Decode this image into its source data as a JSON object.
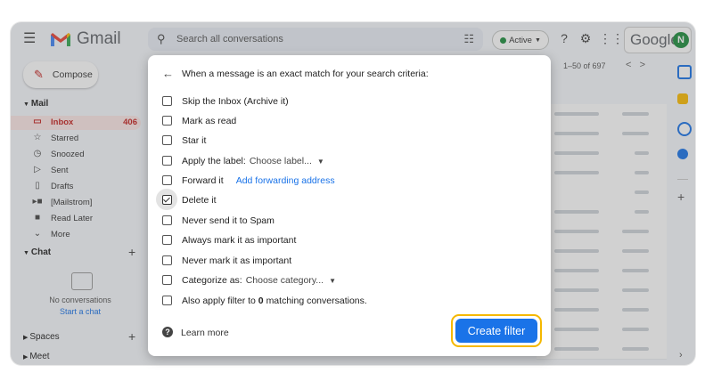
{
  "app": {
    "logo_text": "Gmail",
    "brand_text": "Google",
    "avatar_letter": "N"
  },
  "search": {
    "placeholder": "Search all conversations"
  },
  "status": {
    "label": "Active",
    "color": "#1e8e3e"
  },
  "compose": {
    "label": "Compose"
  },
  "sidebar": {
    "mail_section": "Mail",
    "items": [
      {
        "label": "Inbox",
        "count": "406",
        "icon": "inbox-icon",
        "selected": true
      },
      {
        "label": "Starred",
        "icon": "star-icon"
      },
      {
        "label": "Snoozed",
        "icon": "clock-icon"
      },
      {
        "label": "Sent",
        "icon": "send-icon"
      },
      {
        "label": "Drafts",
        "icon": "draft-icon"
      },
      {
        "label": "[Mailstrom]",
        "icon": "label-icon"
      },
      {
        "label": "Read Later",
        "icon": "label-icon"
      },
      {
        "label": "More",
        "icon": "chevron-down-icon"
      }
    ],
    "chat_section": "Chat",
    "no_conversations": "No conversations",
    "start_chat": "Start a chat",
    "spaces_section": "Spaces",
    "meet_section": "Meet"
  },
  "mail": {
    "range": "1–50 of 697"
  },
  "filter_dialog": {
    "title": "When a message is an exact match for your search criteria:",
    "options": [
      {
        "label": "Skip the Inbox (Archive it)",
        "checked": false
      },
      {
        "label": "Mark as read",
        "checked": false
      },
      {
        "label": "Star it",
        "checked": false
      },
      {
        "label": "Apply the label:",
        "dropdown": "Choose label...",
        "checked": false
      },
      {
        "label": "Forward it",
        "link": "Add forwarding address",
        "checked": false
      },
      {
        "label": "Delete it",
        "checked": true
      },
      {
        "label": "Never send it to Spam",
        "checked": false
      },
      {
        "label": "Always mark it as important",
        "checked": false
      },
      {
        "label": "Never mark it as important",
        "checked": false
      },
      {
        "label": "Categorize as:",
        "dropdown": "Choose category...",
        "checked": false
      },
      {
        "label_prefix": "Also apply filter to",
        "label_count": "0",
        "label_suffix": "matching conversations.",
        "checked": false
      }
    ],
    "learn_more": "Learn more",
    "create_button": "Create filter",
    "accent": "#1a73e8",
    "highlight": "#f5b800"
  }
}
